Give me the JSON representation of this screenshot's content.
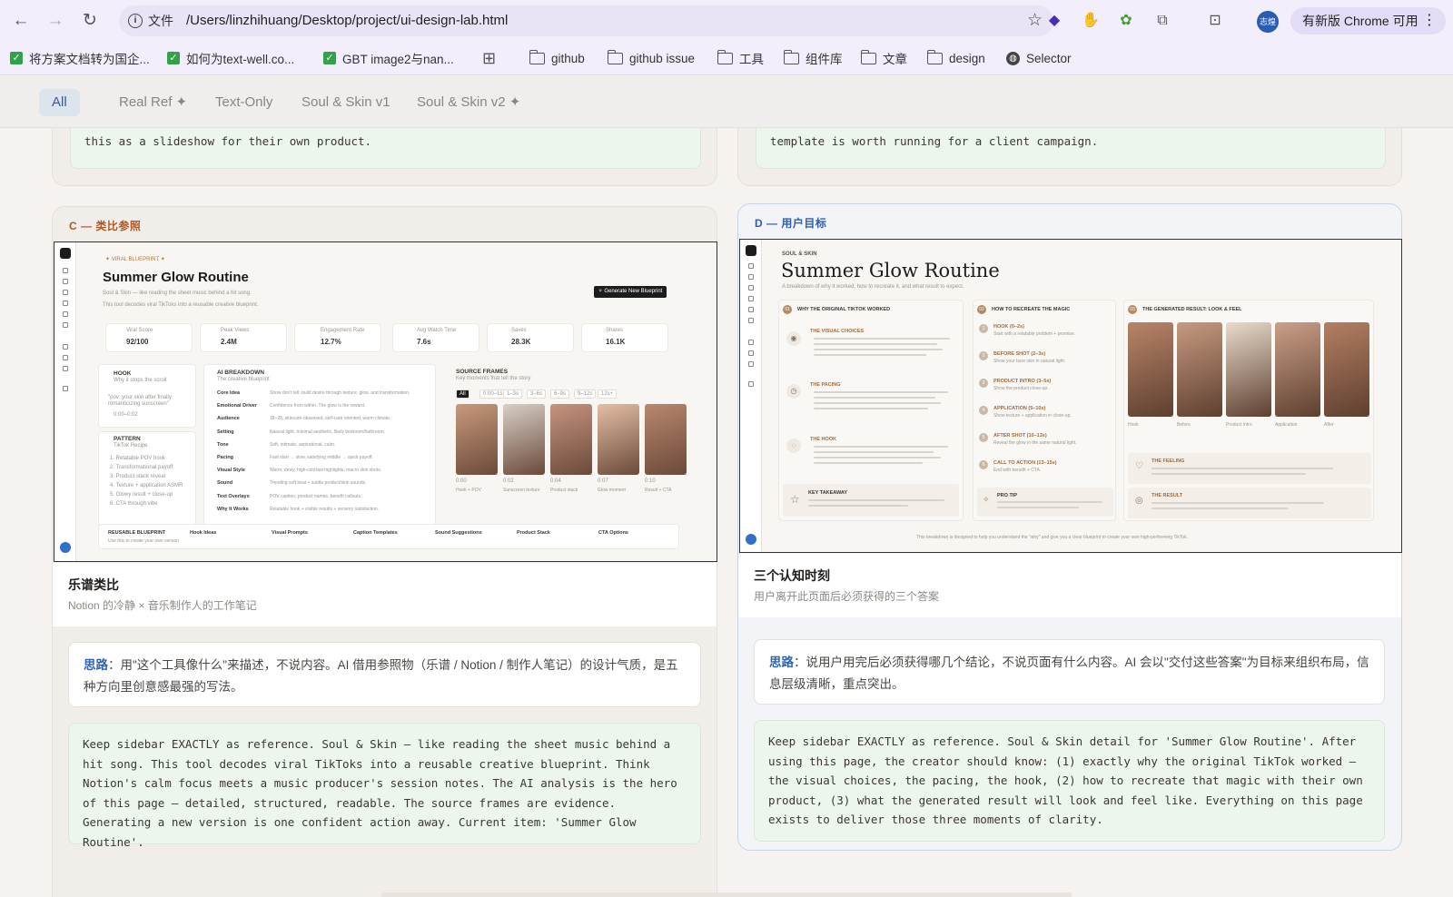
{
  "browser": {
    "back_icon": "←",
    "forward_icon": "→",
    "reload_icon": "↻",
    "site_info_label": "文件",
    "url": "/Users/linzhihuang/Desktop/project/ui-design-lab.html",
    "update_label": "有新版 Chrome 可用",
    "profile_initials": "志煌",
    "bookmarks": [
      {
        "label": "将方案文档转为国企...",
        "icon": "check"
      },
      {
        "label": "如何为text-well.co...",
        "icon": "check"
      },
      {
        "label": "GBT image2与nan...",
        "icon": "check"
      },
      {
        "label": "github",
        "icon": "folder"
      },
      {
        "label": "github issue",
        "icon": "folder"
      },
      {
        "label": "工具",
        "icon": "folder"
      },
      {
        "label": "组件库",
        "icon": "folder"
      },
      {
        "label": "文章",
        "icon": "folder"
      },
      {
        "label": "design",
        "icon": "folder"
      },
      {
        "label": "Selector",
        "icon": "globe"
      }
    ]
  },
  "filters": [
    "All",
    "Real Ref ✦",
    "Text-Only",
    "Soul & Skin v1",
    "Soul & Skin v2 ✦"
  ],
  "active_filter": "All",
  "top_cards": {
    "left_text": "this as a slideshow for their own product.",
    "right_text": "template is worth running for a client campaign."
  },
  "card_c": {
    "tag": "C — 类比参照",
    "title": "乐谱类比",
    "subtitle": "Notion 的冷静 × 音乐制作人的工作笔记",
    "note_label": "思路",
    "note_text": "：用\"这个工具像什么\"来描述，不说内容。AI 借用参照物（乐谱 / Notion / 制作人笔记）的设计气质，是五种方向里创意感最强的写法。",
    "prompt": "Keep sidebar EXACTLY as reference. Soul & Skin — like reading the sheet music behind a hit song. This tool decodes viral TikToks into a reusable creative blueprint. Think Notion's calm focus meets a music producer's session notes. The AI analysis is the hero of this page — detailed, structured, readable. The source frames are evidence. Generating a new version is one confident action away. Current item: 'Summer Glow Routine'.",
    "shot": {
      "eyebrow": "✦ VIRAL BLUEPRINT ✦",
      "title": "Summer Glow Routine",
      "subtitle": "Soul & Skin — like reading the sheet music behind a hit song.",
      "desc": "This tool decodes viral TikToks into a reusable creative blueprint.",
      "button": "✧ Generate New Blueprint",
      "stats": [
        {
          "label": "Viral Score",
          "value": "92/100"
        },
        {
          "label": "Peak Views",
          "value": "2.4M"
        },
        {
          "label": "Engagement Rate",
          "value": "12.7%"
        },
        {
          "label": "Avg Watch Time",
          "value": "7.6s"
        },
        {
          "label": "Saves",
          "value": "28.3K"
        },
        {
          "label": "Shares",
          "value": "16.1K"
        }
      ],
      "hook_title": "HOOK",
      "hook_sub": "Why it stops the scroll",
      "hook_quote": "\"pov: your skin after finally romanticizing sunscreen\"",
      "hook_time": "0:00–0:02",
      "pattern_title": "PATTERN",
      "pattern_sub": "TikTok Recipe",
      "pattern_items": [
        "1. Relatable POV hook",
        "2. Transformational payoff",
        "3. Product stack reveal",
        "4. Texture + application ASMR",
        "5. Glowy result + close-up",
        "6. CTA through vibe"
      ],
      "ai_title": "AI BREAKDOWN",
      "ai_sub": "The creative blueprint",
      "ai_rows": [
        {
          "k": "Core Idea",
          "v": "Show don't tell: build desire through texture, glow, and transformation."
        },
        {
          "k": "Emotional Driver",
          "v": "Confidence from within. The glow is the reward."
        },
        {
          "k": "Audience",
          "v": "18–28, skincare-obsessed, self-care oriented, warm climate."
        },
        {
          "k": "Setting",
          "v": "Natural light, minimal aesthetic, likely bedroom/bathroom."
        },
        {
          "k": "Tone",
          "v": "Soft, intimate, aspirational, calm."
        },
        {
          "k": "Pacing",
          "v": "Fast start → slow, satisfying middle → quick payoff."
        },
        {
          "k": "Visual Style",
          "v": "Warm, dewy, high-contrast highlights, macro skin shots."
        },
        {
          "k": "Sound",
          "v": "Trending soft beat + subtle product/skin sounds."
        },
        {
          "k": "Text Overlays",
          "v": "POV caption, product names, benefit callouts."
        },
        {
          "k": "Why It Works",
          "v": "Relatable hook + visible results + sensory satisfaction."
        }
      ],
      "frames_title": "SOURCE FRAMES",
      "frames_sub": "Key moments that tell the story",
      "frame_tabs": [
        "All",
        "0:00–1s",
        "1–3s",
        "3–6s",
        "6–9s",
        "9–12s",
        "12s+"
      ],
      "frames": [
        {
          "time": "0:00",
          "label": "Hook + POV"
        },
        {
          "time": "0:02",
          "label": "Sunscreen texture"
        },
        {
          "time": "0:04",
          "label": "Product stack"
        },
        {
          "time": "0:07",
          "label": "Glow moment"
        },
        {
          "time": "0:10",
          "label": "Result + CTA"
        }
      ],
      "footer_items": [
        "REUSABLE BLUEPRINT",
        "Hook Ideas",
        "Visual Prompts",
        "Caption Templates",
        "Sound Suggestions",
        "Product Stack",
        "CTA Options"
      ],
      "footer_note": "Use this to create your own version"
    }
  },
  "card_d": {
    "tag": "D — 用户目标",
    "title": "三个认知时刻",
    "subtitle": "用户离开此页面后必须获得的三个答案",
    "note_label": "思路",
    "note_text": "：说用户用完后必须获得哪几个结论，不说页面有什么内容。AI 会以\"交付这些答案\"为目标来组织布局，信息层级清晰，重点突出。",
    "prompt": "Keep sidebar EXACTLY as reference. Soul & Skin detail for 'Summer Glow Routine'. After using this page, the creator should know: (1) exactly why the original TikTok worked — the visual choices, the pacing, the hook, (2) how to recreate that magic with their own product, (3) what the generated result will look and feel like. Everything on this page exists to deliver those three moments of clarity.",
    "shot": {
      "eyebrow": "SOUL & SKIN",
      "title": "Summer Glow Routine",
      "subtitle": "A breakdown of why it worked, how to recreate it, and what result to expect.",
      "col1_title": "WHY THE ORIGINAL TIKTOK WORKED",
      "col2_title": "HOW TO RECREATE THE MAGIC",
      "col3_title": "THE GENERATED RESULT: LOOK & FEEL",
      "visual_title": "THE VISUAL CHOICES",
      "pacing_title": "THE PACING",
      "hook_title": "THE HOOK",
      "takeaway_title": "KEY TAKEAWAY",
      "steps": [
        {
          "t": "HOOK (0–2s)",
          "d": "Start with a relatable problem + promise."
        },
        {
          "t": "BEFORE SHOT (2–3s)",
          "d": "Show your bare skin in natural light."
        },
        {
          "t": "PRODUCT INTRO (3–5s)",
          "d": "Show the product close-up."
        },
        {
          "t": "APPLICATION (5–10s)",
          "d": "Show texture + application in close-up."
        },
        {
          "t": "AFTER SHOT (10–13s)",
          "d": "Reveal the glow in the same natural light."
        },
        {
          "t": "CALL TO ACTION (13–15s)",
          "d": "End with benefit + CTA."
        }
      ],
      "protip_title": "PRO TIP",
      "result_frames": [
        "Hook",
        "Before",
        "Product Intro",
        "Application",
        "After"
      ],
      "feeling_title": "THE FEELING",
      "result_title": "THE RESULT",
      "footer_note": "This breakdown is designed to help you understand the \"why\" and give you a clear blueprint to create your own high-performing TikTok."
    }
  }
}
